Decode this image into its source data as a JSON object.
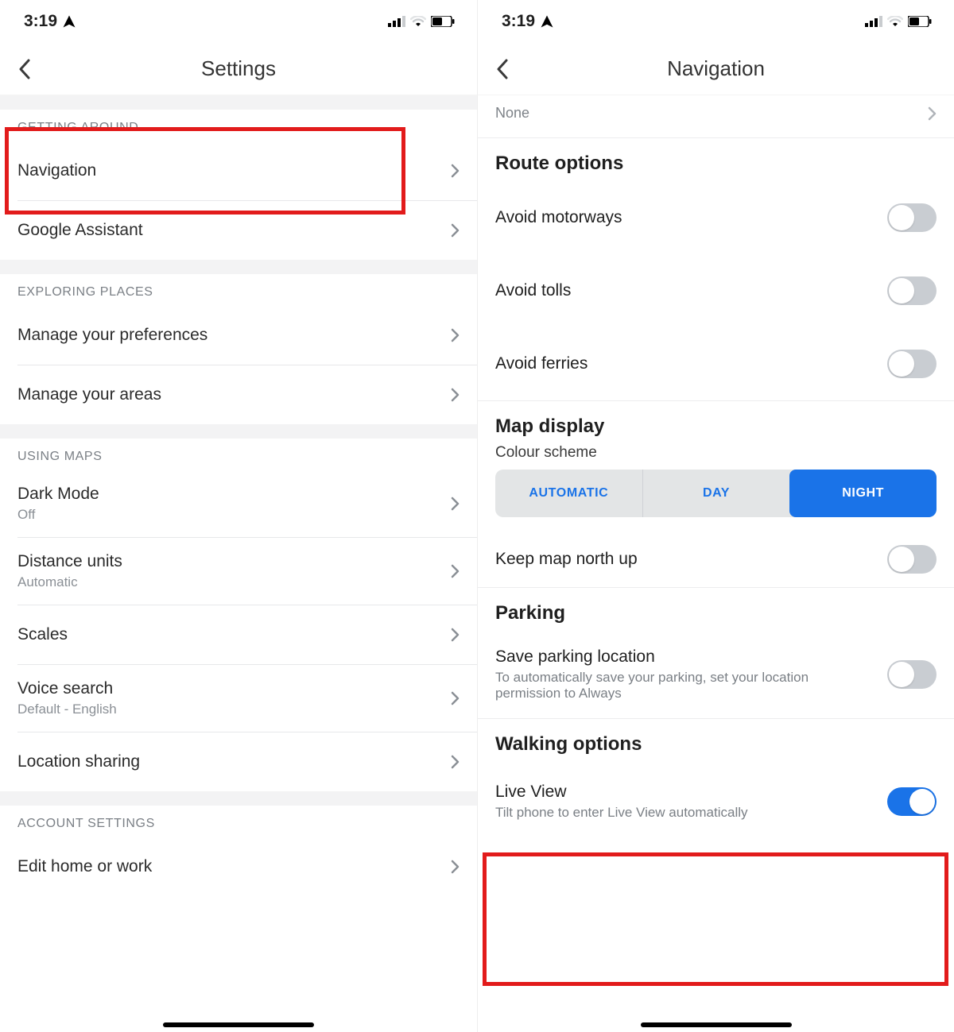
{
  "status": {
    "time": "3:19"
  },
  "left": {
    "title": "Settings",
    "sections": [
      {
        "header": "GETTING AROUND",
        "items": [
          {
            "label": "Navigation"
          },
          {
            "label": "Google Assistant"
          }
        ]
      },
      {
        "header": "EXPLORING PLACES",
        "items": [
          {
            "label": "Manage your preferences"
          },
          {
            "label": "Manage your areas"
          }
        ]
      },
      {
        "header": "USING MAPS",
        "items": [
          {
            "label": "Dark Mode",
            "sub": "Off"
          },
          {
            "label": "Distance units",
            "sub": "Automatic"
          },
          {
            "label": "Scales"
          },
          {
            "label": "Voice search",
            "sub": "Default - English"
          },
          {
            "label": "Location sharing"
          }
        ]
      },
      {
        "header": "ACCOUNT SETTINGS",
        "items": [
          {
            "label": "Edit home or work"
          }
        ]
      }
    ]
  },
  "right": {
    "title": "Navigation",
    "none": "None",
    "route_options": {
      "title": "Route options",
      "items": [
        {
          "label": "Avoid motorways",
          "on": false
        },
        {
          "label": "Avoid tolls",
          "on": false
        },
        {
          "label": "Avoid ferries",
          "on": false
        }
      ]
    },
    "map_display": {
      "title": "Map display",
      "scheme_label": "Colour scheme",
      "scheme": {
        "options": [
          "AUTOMATIC",
          "DAY",
          "NIGHT"
        ],
        "selected": "NIGHT"
      },
      "north_up": {
        "label": "Keep map north up",
        "on": false
      }
    },
    "parking": {
      "title": "Parking",
      "item": {
        "label": "Save parking location",
        "sub": "To automatically save your parking, set your location permission to Always",
        "on": false
      }
    },
    "walking": {
      "title": "Walking options",
      "item": {
        "label": "Live View",
        "sub": "Tilt phone to enter Live View automatically",
        "on": true
      }
    }
  }
}
